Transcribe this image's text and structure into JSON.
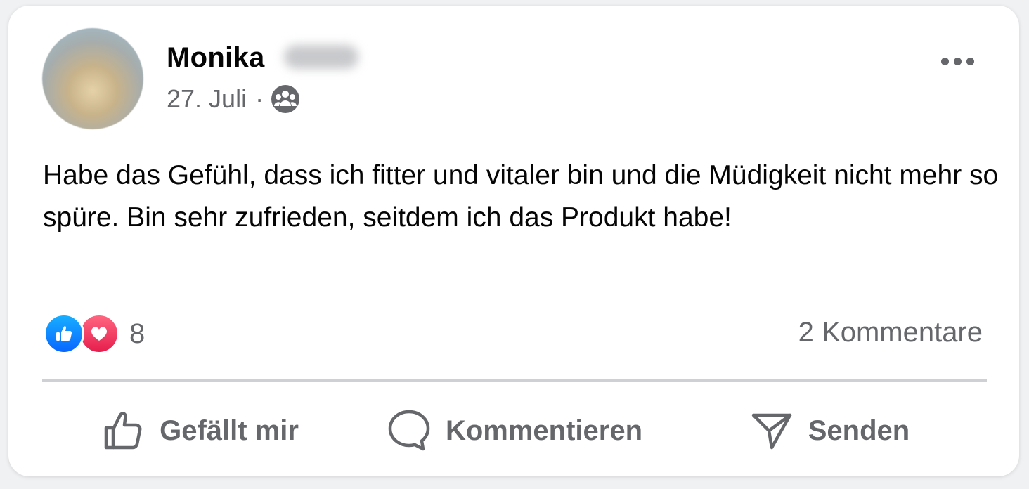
{
  "post": {
    "author_first_name": "Monika",
    "date": "27. Juli",
    "separator": "·",
    "audience_icon": "group-audience-icon",
    "text": "Habe das Gefühl, dass ich fitter und vitaler bin und die Müdigkeit nicht mehr so spüre. Bin sehr zufrieden, seitdem ich das Produkt habe!",
    "more_icon": "more-options-icon"
  },
  "reactions": {
    "count": "8",
    "types": [
      "like-reaction-icon",
      "love-reaction-icon"
    ],
    "comments_label": "2 Kommentare"
  },
  "actions": {
    "like_label": "Gefällt mir",
    "comment_label": "Kommentieren",
    "share_label": "Senden"
  },
  "colors": {
    "like_blue": "#0866ff",
    "love_red": "#e61e4d",
    "secondary_text": "#65676b",
    "primary_text": "#050505"
  }
}
